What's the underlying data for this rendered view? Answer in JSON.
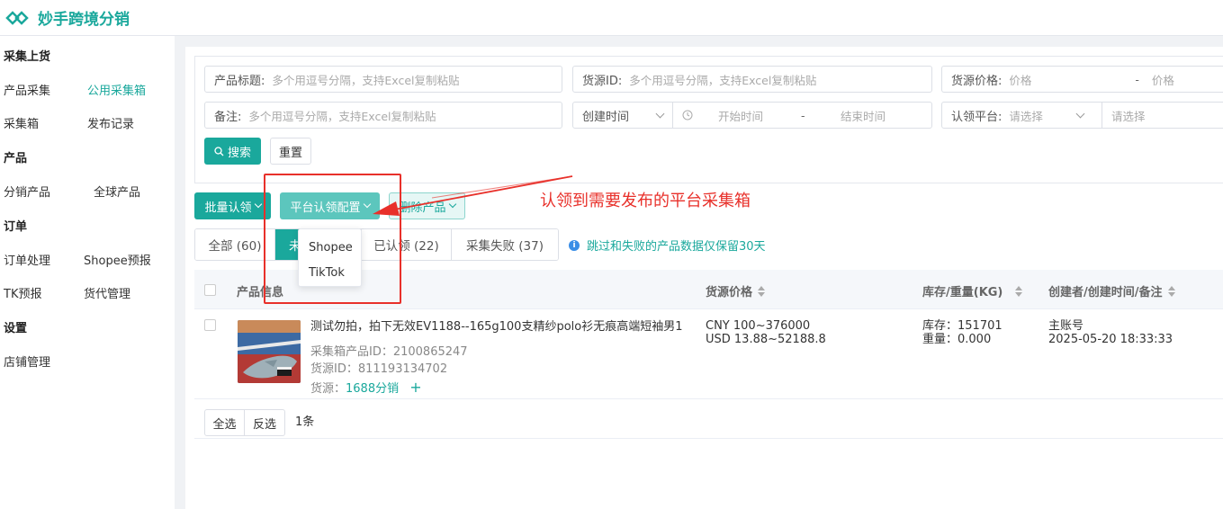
{
  "app": {
    "title": "妙手跨境分销",
    "brand_color": "#1aa89c"
  },
  "sidebar": {
    "sections": [
      {
        "title": "采集上货",
        "items": [
          "产品采集",
          "公用采集箱",
          "采集箱",
          "发布记录"
        ]
      },
      {
        "title": "产品",
        "items": [
          "分销产品",
          "全球产品"
        ]
      },
      {
        "title": "订单",
        "items": [
          "订单处理",
          "Shopee预报",
          "TK预报",
          "货代管理"
        ]
      },
      {
        "title": "设置",
        "items": [
          "店铺管理"
        ]
      }
    ],
    "active": "公用采集箱"
  },
  "filters": {
    "title": {
      "label": "产品标题:",
      "placeholder": "多个用逗号分隔，支持Excel复制粘贴"
    },
    "source_id": {
      "label": "货源ID:",
      "placeholder": "多个用逗号分隔，支持Excel复制粘贴"
    },
    "price": {
      "label": "货源价格:",
      "min_placeholder": "价格",
      "dash": "-",
      "max_placeholder": "价格"
    },
    "remark": {
      "label": "备注:",
      "placeholder": "多个用逗号分隔，支持Excel复制粘贴"
    },
    "time": {
      "select": "创建时间",
      "start": "开始时间",
      "dash": "-",
      "end": "结束时间"
    },
    "platform": {
      "label": "认领平台:",
      "placeholder": "请选择",
      "second_placeholder": "请选择"
    },
    "search_label": "搜索",
    "reset_label": "重置"
  },
  "toolbar": {
    "batch_claim": "批量认领",
    "platform_config": "平台认领配置",
    "delete_products": "删除产品"
  },
  "dropdown": {
    "items": [
      "Shopee",
      "TikTok"
    ]
  },
  "tabs": [
    {
      "label": "全部 (60)",
      "active": false
    },
    {
      "label": "未",
      "active": true
    },
    {
      "label": "已认领 (22)",
      "active": false
    },
    {
      "label": "采集失败 (37)",
      "active": false
    }
  ],
  "notice": {
    "icon": "i",
    "text": "跳过和失败的产品数据仅保留30天"
  },
  "table": {
    "headers": {
      "product": "产品信息",
      "price": "货源价格",
      "stock": "库存/重量(KG)",
      "creator": "创建者/创建时间/备注"
    },
    "rows": [
      {
        "title": "测试勿拍，拍下无效EV1188--165g100支精纱polo衫无痕高端短袖男1",
        "box_id": "采集箱产品ID：2100865247",
        "source_id": "货源ID：811193134702",
        "source_label": "货源：",
        "source_link": "1688分销",
        "plus": "+",
        "price_cny": "CNY 100~376000",
        "price_usd": "USD 13.88~52188.8",
        "stock": "库存：151701",
        "weight": "重量：0.000",
        "creator": "主账号",
        "created_at": "2025-05-20 18:33:33"
      }
    ]
  },
  "footer": {
    "select_all": "全选",
    "invert": "反选",
    "count": "1条"
  },
  "annotation": {
    "text": "认领到需要发布的平台采集箱",
    "color": "#e8302a"
  }
}
